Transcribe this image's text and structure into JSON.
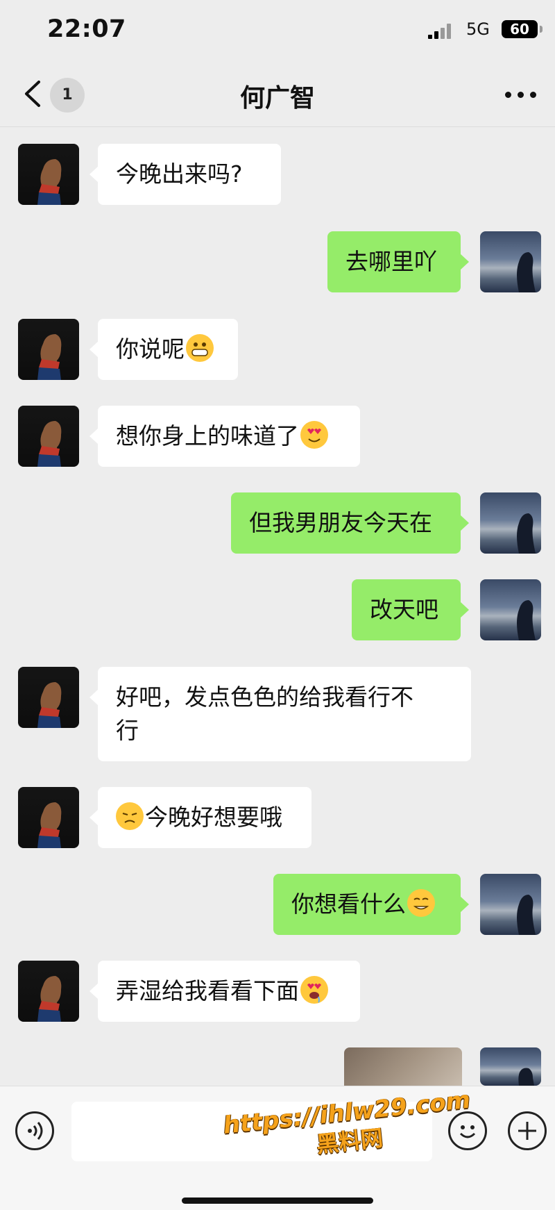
{
  "status_bar": {
    "time": "22:07",
    "network": "5G",
    "battery": "60"
  },
  "nav": {
    "back_badge": "1",
    "title": "何广智"
  },
  "messages": [
    {
      "side": "in",
      "text": "今晚出来吗?"
    },
    {
      "side": "out",
      "text": "去哪里吖"
    },
    {
      "side": "in",
      "text": "你说呢",
      "emoji_after": "grinning-emoji"
    },
    {
      "side": "in",
      "text": "想你身上的味道了",
      "emoji_after": "heart-eyes-emoji"
    },
    {
      "side": "out",
      "text": "但我男朋友今天在"
    },
    {
      "side": "out",
      "text": "改天吧"
    },
    {
      "side": "in",
      "text": "好吧，发点色色的给我看行不\n行"
    },
    {
      "side": "in",
      "text": "今晚好想要哦",
      "emoji_before": "pleading-emoji"
    },
    {
      "side": "out",
      "text": "你想看什么",
      "emoji_after": "smirk-emoji"
    },
    {
      "side": "in",
      "text": "弄湿给我看看下面",
      "emoji_after": "drooling-heart-eyes-emoji"
    },
    {
      "side": "out",
      "type": "image"
    }
  ],
  "watermark": {
    "url": "https://ihlw29.com",
    "name": "黑料网"
  },
  "colors": {
    "background": "#ededed",
    "outgoing_bubble": "#95ec69",
    "incoming_bubble": "#ffffff",
    "watermark": "#f5a21b"
  }
}
